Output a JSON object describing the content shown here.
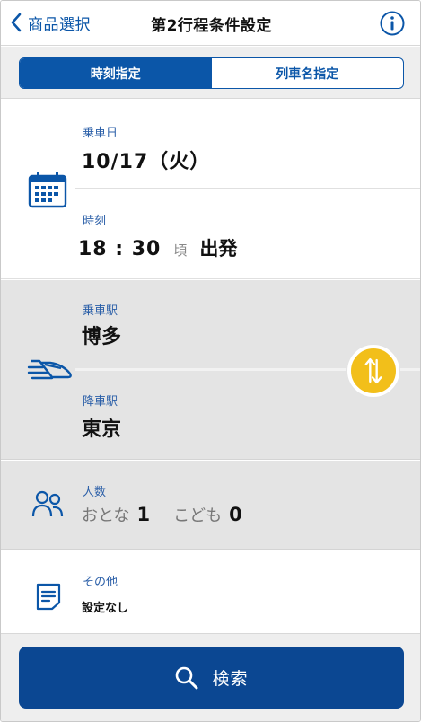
{
  "header": {
    "back_label": "商品選択",
    "title": "第2行程条件設定"
  },
  "tabs": [
    {
      "label": "時刻指定",
      "active": true
    },
    {
      "label": "列車名指定",
      "active": false
    }
  ],
  "date_section": {
    "date_label": "乗車日",
    "date_value": "10/17（火）",
    "time_label": "時刻",
    "time_value": "18 : 30",
    "time_approx": "頃",
    "time_type": "出発"
  },
  "station_section": {
    "departure_label": "乗車駅",
    "departure_value": "博多",
    "arrival_label": "降車駅",
    "arrival_value": "東京"
  },
  "people_section": {
    "label": "人数",
    "adult_label": "おとな",
    "adult_count": "1",
    "child_label": "こども",
    "child_count": "0"
  },
  "other_section": {
    "label": "その他",
    "value": "設定なし"
  },
  "footer": {
    "search_label": "検索"
  },
  "colors": {
    "accent": "#0b56a8",
    "search_button": "#0b4792",
    "swap_button": "#f2bf1a",
    "label_blue": "#2b5fa8"
  }
}
